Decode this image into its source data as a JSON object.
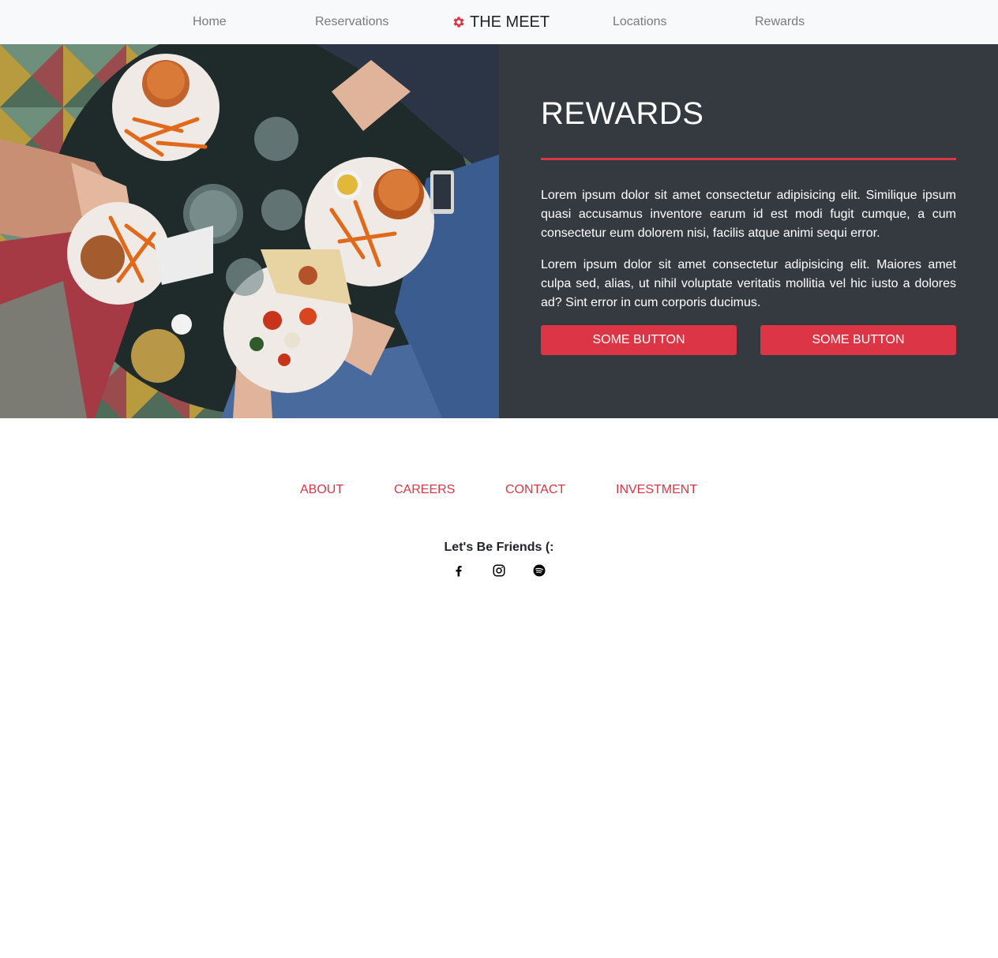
{
  "navbar": {
    "links": {
      "home": "Home",
      "reservations": "Reservations",
      "locations": "Locations",
      "rewards": "Rewards"
    },
    "brand": {
      "icon": "gear-icon",
      "label": "THE MEET"
    }
  },
  "hero": {
    "image": "photo-of-people-eating-burgers-and-fries",
    "title": "REWARDS",
    "paragraphs": [
      "Lorem ipsum dolor sit amet consectetur adipisicing elit. Similique ipsum quasi accusamus inventore earum id est modi fugit cumque, a cum consectetur eum dolorem nisi, facilis atque animi sequi error.",
      "Lorem ipsum dolor sit amet consectetur adipisicing elit. Maiores amet culpa sed, alias, ut nihil voluptate veritatis mollitia vel hic iusto a dolores ad? Sint error in cum corporis ducimus."
    ],
    "buttons": [
      "SOME BUTTON",
      "SOME BUTTON"
    ]
  },
  "footer": {
    "links": [
      "ABOUT",
      "CAREERS",
      "CONTACT",
      "INVESTMENT"
    ],
    "friends_label": "Let's Be Friends (:",
    "social_icons": [
      "facebook-icon",
      "instagram-icon",
      "spotify-icon"
    ]
  },
  "colors": {
    "accent": "#dc3545",
    "panel": "#343a40",
    "navbar_bg": "#f8f9fa"
  }
}
